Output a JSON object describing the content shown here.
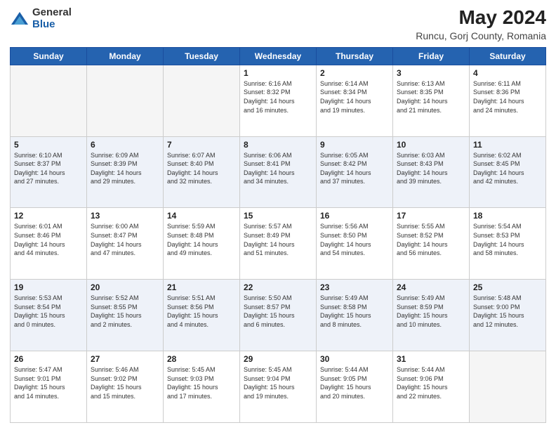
{
  "header": {
    "logo_line1": "General",
    "logo_line2": "Blue",
    "title": "May 2024",
    "location": "Runcu, Gorj County, Romania"
  },
  "days_of_week": [
    "Sunday",
    "Monday",
    "Tuesday",
    "Wednesday",
    "Thursday",
    "Friday",
    "Saturday"
  ],
  "weeks": [
    [
      {
        "num": "",
        "info": "",
        "empty": true
      },
      {
        "num": "",
        "info": "",
        "empty": true
      },
      {
        "num": "",
        "info": "",
        "empty": true
      },
      {
        "num": "1",
        "info": "Sunrise: 6:16 AM\nSunset: 8:32 PM\nDaylight: 14 hours\nand 16 minutes."
      },
      {
        "num": "2",
        "info": "Sunrise: 6:14 AM\nSunset: 8:34 PM\nDaylight: 14 hours\nand 19 minutes."
      },
      {
        "num": "3",
        "info": "Sunrise: 6:13 AM\nSunset: 8:35 PM\nDaylight: 14 hours\nand 21 minutes."
      },
      {
        "num": "4",
        "info": "Sunrise: 6:11 AM\nSunset: 8:36 PM\nDaylight: 14 hours\nand 24 minutes."
      }
    ],
    [
      {
        "num": "5",
        "info": "Sunrise: 6:10 AM\nSunset: 8:37 PM\nDaylight: 14 hours\nand 27 minutes."
      },
      {
        "num": "6",
        "info": "Sunrise: 6:09 AM\nSunset: 8:39 PM\nDaylight: 14 hours\nand 29 minutes."
      },
      {
        "num": "7",
        "info": "Sunrise: 6:07 AM\nSunset: 8:40 PM\nDaylight: 14 hours\nand 32 minutes."
      },
      {
        "num": "8",
        "info": "Sunrise: 6:06 AM\nSunset: 8:41 PM\nDaylight: 14 hours\nand 34 minutes."
      },
      {
        "num": "9",
        "info": "Sunrise: 6:05 AM\nSunset: 8:42 PM\nDaylight: 14 hours\nand 37 minutes."
      },
      {
        "num": "10",
        "info": "Sunrise: 6:03 AM\nSunset: 8:43 PM\nDaylight: 14 hours\nand 39 minutes."
      },
      {
        "num": "11",
        "info": "Sunrise: 6:02 AM\nSunset: 8:45 PM\nDaylight: 14 hours\nand 42 minutes."
      }
    ],
    [
      {
        "num": "12",
        "info": "Sunrise: 6:01 AM\nSunset: 8:46 PM\nDaylight: 14 hours\nand 44 minutes."
      },
      {
        "num": "13",
        "info": "Sunrise: 6:00 AM\nSunset: 8:47 PM\nDaylight: 14 hours\nand 47 minutes."
      },
      {
        "num": "14",
        "info": "Sunrise: 5:59 AM\nSunset: 8:48 PM\nDaylight: 14 hours\nand 49 minutes."
      },
      {
        "num": "15",
        "info": "Sunrise: 5:57 AM\nSunset: 8:49 PM\nDaylight: 14 hours\nand 51 minutes."
      },
      {
        "num": "16",
        "info": "Sunrise: 5:56 AM\nSunset: 8:50 PM\nDaylight: 14 hours\nand 54 minutes."
      },
      {
        "num": "17",
        "info": "Sunrise: 5:55 AM\nSunset: 8:52 PM\nDaylight: 14 hours\nand 56 minutes."
      },
      {
        "num": "18",
        "info": "Sunrise: 5:54 AM\nSunset: 8:53 PM\nDaylight: 14 hours\nand 58 minutes."
      }
    ],
    [
      {
        "num": "19",
        "info": "Sunrise: 5:53 AM\nSunset: 8:54 PM\nDaylight: 15 hours\nand 0 minutes."
      },
      {
        "num": "20",
        "info": "Sunrise: 5:52 AM\nSunset: 8:55 PM\nDaylight: 15 hours\nand 2 minutes."
      },
      {
        "num": "21",
        "info": "Sunrise: 5:51 AM\nSunset: 8:56 PM\nDaylight: 15 hours\nand 4 minutes."
      },
      {
        "num": "22",
        "info": "Sunrise: 5:50 AM\nSunset: 8:57 PM\nDaylight: 15 hours\nand 6 minutes."
      },
      {
        "num": "23",
        "info": "Sunrise: 5:49 AM\nSunset: 8:58 PM\nDaylight: 15 hours\nand 8 minutes."
      },
      {
        "num": "24",
        "info": "Sunrise: 5:49 AM\nSunset: 8:59 PM\nDaylight: 15 hours\nand 10 minutes."
      },
      {
        "num": "25",
        "info": "Sunrise: 5:48 AM\nSunset: 9:00 PM\nDaylight: 15 hours\nand 12 minutes."
      }
    ],
    [
      {
        "num": "26",
        "info": "Sunrise: 5:47 AM\nSunset: 9:01 PM\nDaylight: 15 hours\nand 14 minutes."
      },
      {
        "num": "27",
        "info": "Sunrise: 5:46 AM\nSunset: 9:02 PM\nDaylight: 15 hours\nand 15 minutes."
      },
      {
        "num": "28",
        "info": "Sunrise: 5:45 AM\nSunset: 9:03 PM\nDaylight: 15 hours\nand 17 minutes."
      },
      {
        "num": "29",
        "info": "Sunrise: 5:45 AM\nSunset: 9:04 PM\nDaylight: 15 hours\nand 19 minutes."
      },
      {
        "num": "30",
        "info": "Sunrise: 5:44 AM\nSunset: 9:05 PM\nDaylight: 15 hours\nand 20 minutes."
      },
      {
        "num": "31",
        "info": "Sunrise: 5:44 AM\nSunset: 9:06 PM\nDaylight: 15 hours\nand 22 minutes."
      },
      {
        "num": "",
        "info": "",
        "empty": true
      }
    ]
  ]
}
